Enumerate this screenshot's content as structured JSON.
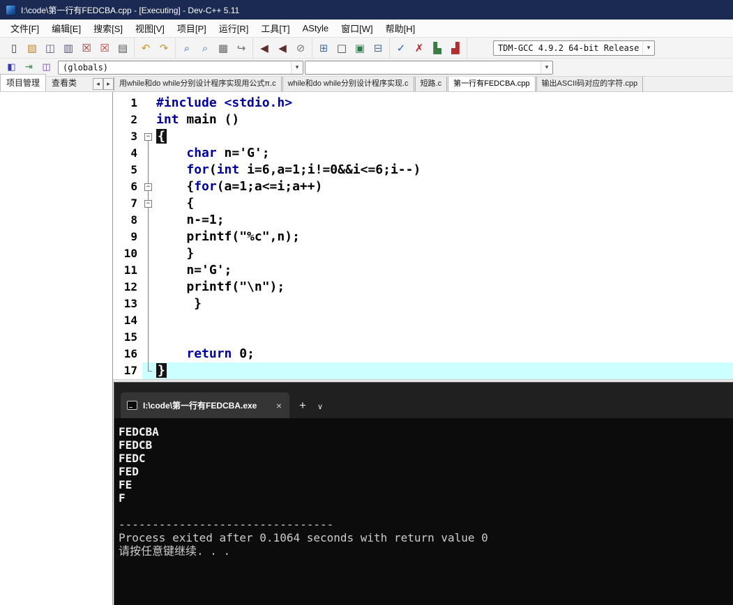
{
  "window": {
    "title": "I:\\code\\第一行有FEDCBA.cpp - [Executing] - Dev-C++ 5.11"
  },
  "icons": {
    "dropdown": "▾",
    "left": "◂",
    "right": "▸"
  },
  "menu": {
    "items": [
      "文件[F]",
      "编辑[E]",
      "搜索[S]",
      "视图[V]",
      "项目[P]",
      "运行[R]",
      "工具[T]",
      "AStyle",
      "窗口[W]",
      "帮助[H]"
    ]
  },
  "toolbar": {
    "compiler": "TDM-GCC 4.9.2 64-bit Release",
    "groups": [
      {
        "buttons": [
          {
            "name": "new-file-button",
            "glyph": "▯",
            "color": "#3a3a3a"
          },
          {
            "name": "open-file-button",
            "glyph": "▨",
            "color": "#c08a2d"
          },
          {
            "name": "save-button",
            "glyph": "◫",
            "color": "#5a5a7a"
          },
          {
            "name": "save-all-button",
            "glyph": "▥",
            "color": "#5a5a7a"
          },
          {
            "name": "close-file-button",
            "glyph": "☒",
            "color": "#a03535"
          },
          {
            "name": "close-all-button",
            "glyph": "☒",
            "color": "#c04040"
          },
          {
            "name": "print-button",
            "glyph": "▤",
            "color": "#555555"
          }
        ]
      },
      {
        "buttons": [
          {
            "name": "undo-button",
            "glyph": "↶",
            "color": "#c79a2e"
          },
          {
            "name": "redo-button",
            "glyph": "↷",
            "color": "#c79a2e"
          }
        ]
      },
      {
        "buttons": [
          {
            "name": "find-button",
            "glyph": "⌕",
            "color": "#1c5fba"
          },
          {
            "name": "find-in-files-button",
            "glyph": "⌕",
            "color": "#3a78c9"
          },
          {
            "name": "replace-button",
            "glyph": "▩",
            "color": "#6a6a6a"
          },
          {
            "name": "goto-line-button",
            "glyph": "↪",
            "color": "#6a6a6a"
          }
        ]
      },
      {
        "buttons": [
          {
            "name": "back-button",
            "glyph": "◀",
            "color": "#5c2e2e"
          },
          {
            "name": "forward-button",
            "glyph": "◀",
            "color": "#5c2e2e"
          },
          {
            "name": "abort-button",
            "glyph": "⊘",
            "color": "#7a7a7a"
          }
        ]
      },
      {
        "buttons": [
          {
            "name": "compile-button",
            "glyph": "⊞",
            "color": "#4a6fa5"
          },
          {
            "name": "run-button",
            "glyph": "□",
            "color": "#444444"
          },
          {
            "name": "compile-run-button",
            "glyph": "▣",
            "color": "#2f7d4f"
          },
          {
            "name": "rebuild-button",
            "glyph": "⊟",
            "color": "#4a6fa5"
          }
        ]
      },
      {
        "buttons": [
          {
            "name": "syntax-check-button",
            "glyph": "✓",
            "color": "#1f5fd0"
          },
          {
            "name": "stop-execution-button",
            "glyph": "✗",
            "color": "#c02020"
          },
          {
            "name": "profile-button",
            "glyph": "▙",
            "color": "#3a7d44"
          },
          {
            "name": "profile-analysis-button",
            "glyph": "▟",
            "color": "#b03030"
          }
        ]
      }
    ],
    "extra_buttons": [
      {
        "name": "goto-declaration-button",
        "glyph": "◧",
        "color": "#3b3bb0"
      },
      {
        "name": "goto-implementation-button",
        "glyph": "⇥",
        "color": "#2d8a3e"
      },
      {
        "name": "class-browser-button",
        "glyph": "◫",
        "color": "#6a3ab0"
      }
    ],
    "globals": "(globals)",
    "members": ""
  },
  "panel": {
    "tabs": [
      "项目管理",
      "查看类"
    ]
  },
  "editor_tabs": {
    "active": 3,
    "items": [
      "用while和do while分别设计程序实现用公式π.c",
      "while和do while分别设计程序实现.c",
      "短路.c",
      "第一行有FEDCBA.cpp",
      "输出ASCII码对应的字符.cpp"
    ]
  },
  "editor": {
    "lines": [
      {
        "n": 1,
        "fold": "none",
        "segs": [
          [
            "kw",
            "#include <stdio.h>"
          ]
        ]
      },
      {
        "n": 2,
        "fold": "none",
        "segs": [
          [
            "kw",
            "int"
          ],
          [
            "pl",
            " main ()"
          ]
        ]
      },
      {
        "n": 3,
        "fold": "box-start",
        "segs": [
          [
            "br",
            "{"
          ]
        ]
      },
      {
        "n": 4,
        "fold": "line",
        "segs": [
          [
            "pl",
            "    "
          ],
          [
            "kw",
            "char"
          ],
          [
            "pl",
            " n='G';"
          ]
        ]
      },
      {
        "n": 5,
        "fold": "line",
        "segs": [
          [
            "pl",
            "    "
          ],
          [
            "kw",
            "for"
          ],
          [
            "pl",
            "("
          ],
          [
            "kw",
            "int"
          ],
          [
            "pl",
            " i=6,a=1;i!=0&&i<=6;i--)"
          ]
        ]
      },
      {
        "n": 6,
        "fold": "box-mid",
        "segs": [
          [
            "pl",
            "    {"
          ],
          [
            "kw",
            "for"
          ],
          [
            "pl",
            "(a=1;a<=i;a++)"
          ]
        ]
      },
      {
        "n": 7,
        "fold": "box-mid",
        "segs": [
          [
            "pl",
            "    {"
          ]
        ]
      },
      {
        "n": 8,
        "fold": "line",
        "segs": [
          [
            "pl",
            "    n-=1;"
          ]
        ]
      },
      {
        "n": 9,
        "fold": "line",
        "segs": [
          [
            "pl",
            "    printf(\"%c\",n);"
          ]
        ]
      },
      {
        "n": 10,
        "fold": "line",
        "segs": [
          [
            "pl",
            "    }"
          ]
        ]
      },
      {
        "n": 11,
        "fold": "line",
        "segs": [
          [
            "pl",
            "    n='G';"
          ]
        ]
      },
      {
        "n": 12,
        "fold": "line",
        "segs": [
          [
            "pl",
            "    printf(\"\\n\");"
          ]
        ]
      },
      {
        "n": 13,
        "fold": "line",
        "segs": [
          [
            "pl",
            "     }"
          ]
        ]
      },
      {
        "n": 14,
        "fold": "line",
        "segs": []
      },
      {
        "n": 15,
        "fold": "line",
        "segs": []
      },
      {
        "n": 16,
        "fold": "line",
        "segs": [
          [
            "pl",
            "    "
          ],
          [
            "kw",
            "return"
          ],
          [
            "pl",
            " 0;"
          ]
        ]
      },
      {
        "n": 17,
        "fold": "end",
        "active": true,
        "segs": [
          [
            "br",
            "}"
          ]
        ]
      }
    ]
  },
  "terminal": {
    "tab": "I:\\code\\第一行有FEDCBA.exe",
    "close_icon": "×",
    "new_tab_icon": "+",
    "dropdown_icon": "∨",
    "output": [
      {
        "text": "FEDCBA",
        "bold": true
      },
      {
        "text": "FEDCB",
        "bold": true
      },
      {
        "text": "FEDC",
        "bold": true
      },
      {
        "text": "FED",
        "bold": true
      },
      {
        "text": "FE",
        "bold": true
      },
      {
        "text": "F",
        "bold": true
      },
      {
        "text": "",
        "bold": false
      },
      {
        "text": "--------------------------------",
        "bold": false
      },
      {
        "text": "Process exited after 0.1064 seconds with return value 0",
        "bold": false
      },
      {
        "text": "请按任意键继续. . .",
        "bold": false
      }
    ]
  }
}
